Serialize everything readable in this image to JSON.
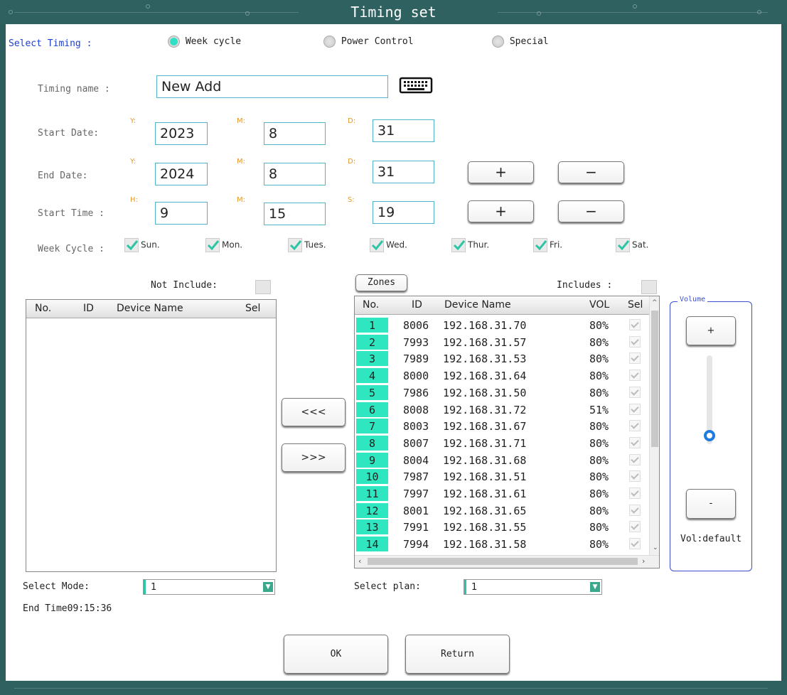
{
  "window": {
    "title": "Timing set"
  },
  "select_timing": {
    "label": "Select Timing :",
    "options": [
      "Week cycle",
      "Power Control",
      "Special"
    ],
    "selected": "Week cycle"
  },
  "timing_name": {
    "label": "Timing name :",
    "value": "New Add",
    "keyboard_icon": "keyboard-icon"
  },
  "start_date": {
    "label": "Start Date:",
    "y_label": "Y:",
    "m_label": "M:",
    "d_label": "D:",
    "year": "2023",
    "month": "8",
    "day": "31"
  },
  "end_date": {
    "label": "End Date:",
    "y_label": "Y:",
    "m_label": "M:",
    "d_label": "D:",
    "year": "2024",
    "month": "8",
    "day": "31"
  },
  "start_time": {
    "label": "Start Time  :",
    "h_label": "H:",
    "m_label": "M:",
    "s_label": "S:",
    "hour": "9",
    "minute": "15",
    "second": "19"
  },
  "plus_minus": {
    "plus": "+",
    "minus": "−"
  },
  "week_cycle": {
    "label": "Week Cycle  :",
    "days": [
      "Sun.",
      "Mon.",
      "Tues.",
      "Wed.",
      "Thur.",
      "Fri.",
      "Sat."
    ]
  },
  "left_list": {
    "not_include_label": "Not Include:",
    "columns": [
      "No.",
      "ID",
      "Device Name",
      "Sel"
    ]
  },
  "transfer": {
    "left": "<<<",
    "right": ">>>"
  },
  "right_list": {
    "zones_button": "Zones",
    "includes_label": "Includes :",
    "columns": [
      "No.",
      "ID",
      "Device Name",
      "VOL",
      "Sel"
    ],
    "rows": [
      {
        "no": "1",
        "id": "8006",
        "name": "192.168.31.70",
        "vol": "80%"
      },
      {
        "no": "2",
        "id": "7993",
        "name": "192.168.31.57",
        "vol": "80%"
      },
      {
        "no": "3",
        "id": "7989",
        "name": "192.168.31.53",
        "vol": "80%"
      },
      {
        "no": "4",
        "id": "8000",
        "name": "192.168.31.64",
        "vol": "80%"
      },
      {
        "no": "5",
        "id": "7986",
        "name": "192.168.31.50",
        "vol": "80%"
      },
      {
        "no": "6",
        "id": "8008",
        "name": "192.168.31.72",
        "vol": "51%"
      },
      {
        "no": "7",
        "id": "8003",
        "name": "192.168.31.67",
        "vol": "80%"
      },
      {
        "no": "8",
        "id": "8007",
        "name": "192.168.31.71",
        "vol": "80%"
      },
      {
        "no": "9",
        "id": "8004",
        "name": "192.168.31.68",
        "vol": "80%"
      },
      {
        "no": "10",
        "id": "7987",
        "name": "192.168.31.51",
        "vol": "80%"
      },
      {
        "no": "11",
        "id": "7997",
        "name": "192.168.31.61",
        "vol": "80%"
      },
      {
        "no": "12",
        "id": "8001",
        "name": "192.168.31.65",
        "vol": "80%"
      },
      {
        "no": "13",
        "id": "7991",
        "name": "192.168.31.55",
        "vol": "80%"
      },
      {
        "no": "14",
        "id": "7994",
        "name": "192.168.31.58",
        "vol": "80%"
      }
    ]
  },
  "volume": {
    "title": "Volume",
    "plus": "+",
    "minus": "-",
    "status": "Vol:default",
    "level_fraction": 0.1
  },
  "select_mode": {
    "label": "Select Mode:",
    "value": "1"
  },
  "select_plan": {
    "label": "Select  plan:",
    "value": "1"
  },
  "end_time": {
    "text": "End Time09:15:36"
  },
  "actions": {
    "ok": "OK",
    "return": "Return"
  },
  "colors": {
    "frame": "#2f6161",
    "accent": "#2ee6c0",
    "label_blue": "#1b3fd6",
    "orange": "#e39a2a",
    "input_border": "#4fb3c9"
  }
}
